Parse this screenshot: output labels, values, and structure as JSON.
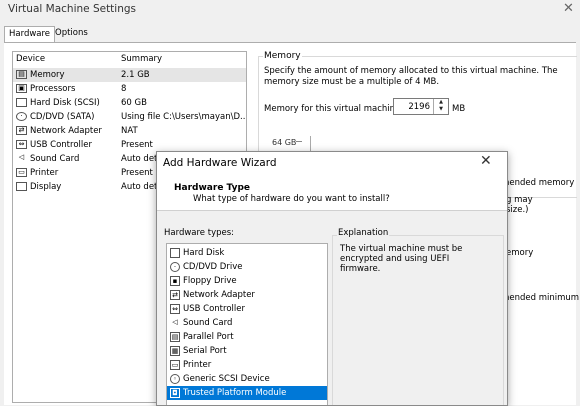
{
  "window": {
    "title": "Virtual Machine Settings",
    "close_glyph": "✕"
  },
  "tabs": [
    {
      "label": "Hardware"
    },
    {
      "label": "Options"
    }
  ],
  "device_list": {
    "headers": {
      "device": "Device",
      "summary": "Summary"
    },
    "rows": [
      {
        "name": "Memory",
        "summary": "2.1 GB",
        "icon": "memory-icon",
        "selected": true
      },
      {
        "name": "Processors",
        "summary": "8",
        "icon": "processor-icon"
      },
      {
        "name": "Hard Disk (SCSI)",
        "summary": "60 GB",
        "icon": "hard-disk-icon"
      },
      {
        "name": "CD/DVD (SATA)",
        "summary": "Using file C:\\Users\\mayan\\D...",
        "icon": "cd-dvd-icon"
      },
      {
        "name": "Network Adapter",
        "summary": "NAT",
        "icon": "network-adapter-icon"
      },
      {
        "name": "USB Controller",
        "summary": "Present",
        "icon": "usb-icon"
      },
      {
        "name": "Sound Card",
        "summary": "Auto dete",
        "icon": "speaker-icon"
      },
      {
        "name": "Printer",
        "summary": "Present",
        "icon": "printer-icon"
      },
      {
        "name": "Display",
        "summary": "Auto dete",
        "icon": "display-icon"
      }
    ]
  },
  "memory": {
    "group_title": "Memory",
    "description": "Specify the amount of memory allocated to this virtual machine. The memory size must be a multiple of 4 MB.",
    "field_label": "Memory for this virtual machine:",
    "value": "2196",
    "unit": "MB",
    "scale_top": "64 GB",
    "partial_texts": [
      "nended memory",
      "g may",
      "size.)",
      "emory",
      "nended minimum"
    ]
  },
  "wizard": {
    "title": "Add Hardware Wizard",
    "close_glyph": "✕",
    "heading": "Hardware Type",
    "subheading": "What type of hardware do you want to install?",
    "types_label": "Hardware types:",
    "types": [
      {
        "name": "Hard Disk",
        "icon": "hard-disk-icon"
      },
      {
        "name": "CD/DVD Drive",
        "icon": "cd-dvd-icon"
      },
      {
        "name": "Floppy Drive",
        "icon": "floppy-icon"
      },
      {
        "name": "Network Adapter",
        "icon": "network-adapter-icon"
      },
      {
        "name": "USB Controller",
        "icon": "usb-icon"
      },
      {
        "name": "Sound Card",
        "icon": "speaker-icon"
      },
      {
        "name": "Parallel Port",
        "icon": "parallel-port-icon"
      },
      {
        "name": "Serial Port",
        "icon": "serial-port-icon"
      },
      {
        "name": "Printer",
        "icon": "printer-icon"
      },
      {
        "name": "Generic SCSI Device",
        "icon": "scsi-icon"
      },
      {
        "name": "Trusted Platform Module",
        "icon": "tpm-icon",
        "selected": true
      }
    ],
    "explanation_label": "Explanation",
    "explanation": "The virtual machine must be encrypted and using UEFI firmware."
  },
  "colors": {
    "selection": "#0078d7",
    "window_bg": "#f0f0f0"
  }
}
